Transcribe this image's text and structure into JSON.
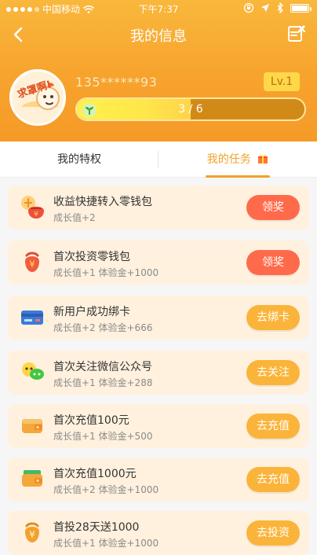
{
  "status_bar": {
    "carrier": "中国移动",
    "time": "下午7:37"
  },
  "nav": {
    "title": "我的信息",
    "back_icon": "chevron-left-icon",
    "edit_icon": "edit-note-icon"
  },
  "profile": {
    "avatar_text": "求罩啊!",
    "phone": "135******93",
    "level": "Lv.1",
    "progress_text": "3 / 6",
    "progress_value": 0.5
  },
  "tabs": {
    "left": "我的特权",
    "right": "我的任务"
  },
  "tasks": [
    {
      "title": "收益快捷转入零钱包",
      "subtitle": "成长值+2",
      "button": "领奖",
      "style": "red",
      "icon": "coin-bag-icon"
    },
    {
      "title": "首次投资零钱包",
      "subtitle": "成长值+1 体验金+1000",
      "button": "领奖",
      "style": "red",
      "icon": "money-bag-icon"
    },
    {
      "title": "新用户成功绑卡",
      "subtitle": "成长值+2 体验金+666",
      "button": "去绑卡",
      "style": "yellow",
      "icon": "card-icon"
    },
    {
      "title": "首次关注微信公众号",
      "subtitle": "成长值+1 体验金+288",
      "button": "去关注",
      "style": "yellow",
      "icon": "wechat-icon"
    },
    {
      "title": "首次充值100元",
      "subtitle": "成长值+1 体验金+500",
      "button": "去充值",
      "style": "yellow",
      "icon": "wallet-icon"
    },
    {
      "title": "首次充值1000元",
      "subtitle": "成长值+2 体验金+1000",
      "button": "去充值",
      "style": "yellow",
      "icon": "cash-wallet-icon"
    },
    {
      "title": "首投28天送1000",
      "subtitle": "成长值+1 体验金+1000",
      "button": "去投资",
      "style": "yellow",
      "icon": "money-bag-icon"
    }
  ]
}
